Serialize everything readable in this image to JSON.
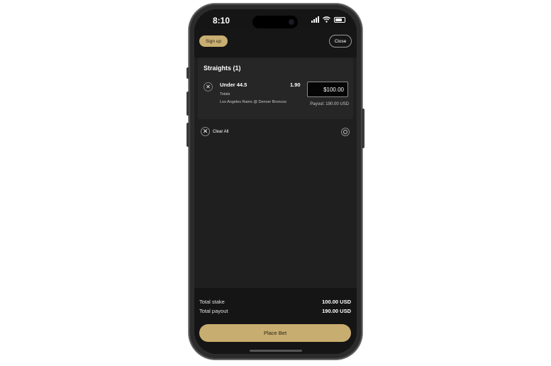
{
  "status_bar": {
    "time": "8:10"
  },
  "header": {
    "signup_label": "Sign up",
    "close_label": "Close"
  },
  "betslip": {
    "section_title": "Straights (1)",
    "selection": {
      "name": "Under 44.5",
      "market": "Totals",
      "event": "Los Angeles Rams @ Denver Broncos",
      "odds": "1.90",
      "stake": "$100.00",
      "payout": "Payout: 190.00 USD"
    },
    "clear_all_label": "Clear All"
  },
  "summary": {
    "total_stake_label": "Total stake",
    "total_stake_value": "100.00 USD",
    "total_payout_label": "Total payout",
    "total_payout_value": "190.00 USD"
  },
  "place_bet_label": "Place Bet",
  "colors": {
    "accent": "#c8ad70",
    "background": "#1f1f1f"
  },
  "icons": {
    "remove": "close-icon",
    "clear": "close-icon",
    "settings": "settings-icon",
    "wifi": "wifi-icon",
    "battery": "battery-icon",
    "signal": "signal-icon"
  }
}
